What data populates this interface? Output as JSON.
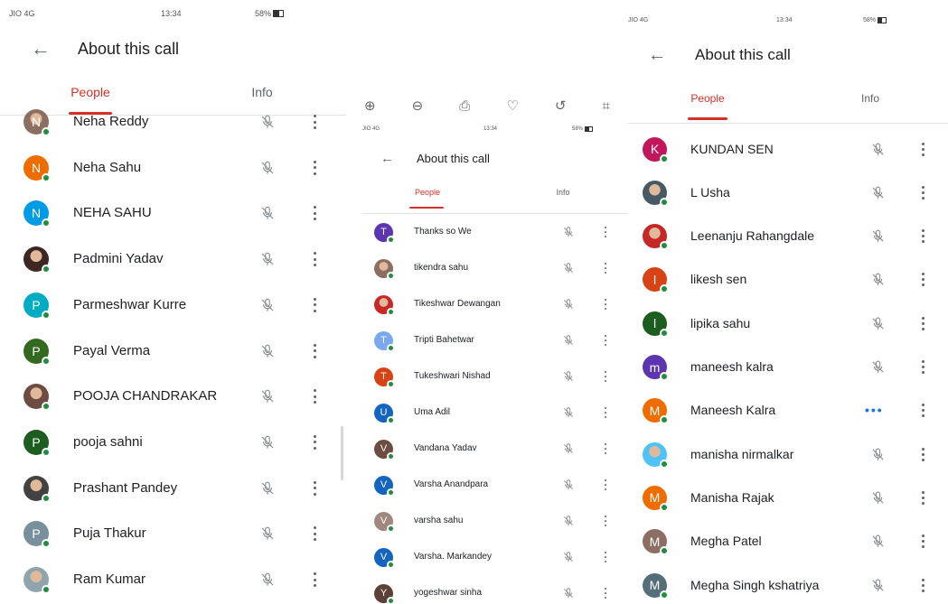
{
  "left": {
    "status": {
      "carrier": "JIO 4G",
      "time": "13:34",
      "battery": "58%"
    },
    "title": "About this call",
    "tabs": [
      "People",
      "Info"
    ],
    "people": [
      {
        "name": "Neha Reddy",
        "initial": "N",
        "color": "#8d6e63",
        "kind": "photo"
      },
      {
        "name": "Neha Sahu",
        "initial": "N",
        "color": "#ef6c00",
        "kind": "letter"
      },
      {
        "name": "NEHA SAHU",
        "initial": "N",
        "color": "#039be5",
        "kind": "letter"
      },
      {
        "name": "Padmini Yadav",
        "initial": "",
        "color": "#3e2723",
        "kind": "photo"
      },
      {
        "name": "Parmeshwar Kurre",
        "initial": "P",
        "color": "#00acc1",
        "kind": "letter"
      },
      {
        "name": "Payal Verma",
        "initial": "P",
        "color": "#33691e",
        "kind": "letter"
      },
      {
        "name": "POOJA CHANDRAKAR",
        "initial": "",
        "color": "#6d4c41",
        "kind": "photo"
      },
      {
        "name": "pooja sahni",
        "initial": "P",
        "color": "#1b5e20",
        "kind": "letter"
      },
      {
        "name": "Prashant Pandey",
        "initial": "",
        "color": "#424242",
        "kind": "photo"
      },
      {
        "name": "Puja Thakur",
        "initial": "P",
        "color": "#78909c",
        "kind": "letter"
      },
      {
        "name": "Ram Kumar",
        "initial": "",
        "color": "#90a4ae",
        "kind": "photo"
      }
    ]
  },
  "middle": {
    "toolbar": [
      "zoom-in",
      "zoom-out",
      "delete",
      "favorite",
      "rotate",
      "crop"
    ],
    "status": {
      "carrier": "JIO 4G",
      "time": "13:34",
      "battery": "58%"
    },
    "title": "About this call",
    "tabs": [
      "People",
      "Info"
    ],
    "people": [
      {
        "name": "Thanks so We",
        "initial": "T",
        "color": "#5e35b1",
        "kind": "letter"
      },
      {
        "name": "tikendra sahu",
        "initial": "",
        "color": "#8d6e63",
        "kind": "photo"
      },
      {
        "name": "Tikeshwar Dewangan",
        "initial": "",
        "color": "#c62828",
        "kind": "photo"
      },
      {
        "name": "Tripti Bahetwar",
        "initial": "T",
        "color": "#7aa7ee",
        "kind": "letter"
      },
      {
        "name": "Tukeshwari Nishad",
        "initial": "T",
        "color": "#d84315",
        "kind": "letter"
      },
      {
        "name": "Uma Adil",
        "initial": "U",
        "color": "#1565c0",
        "kind": "letter"
      },
      {
        "name": "Vandana Yadav",
        "initial": "V",
        "color": "#6d4c41",
        "kind": "letter"
      },
      {
        "name": "Varsha Anandpara",
        "initial": "V",
        "color": "#1565c0",
        "kind": "letter"
      },
      {
        "name": "varsha sahu",
        "initial": "V",
        "color": "#a1887f",
        "kind": "letter"
      },
      {
        "name": "Varsha. Markandey",
        "initial": "V",
        "color": "#1565c0",
        "kind": "letter"
      },
      {
        "name": "yogeshwar sinha",
        "initial": "Y",
        "color": "#5d4037",
        "kind": "letter"
      }
    ]
  },
  "right": {
    "status": {
      "carrier": "JIO 4G",
      "time": "13:34",
      "battery": "58%"
    },
    "title": "About this call",
    "tabs": [
      "People",
      "Info"
    ],
    "people": [
      {
        "name": "KUNDAN SEN",
        "initial": "K",
        "color": "#c2185b",
        "kind": "letter",
        "talking": false
      },
      {
        "name": "L Usha",
        "initial": "",
        "color": "#455a64",
        "kind": "photo",
        "talking": false
      },
      {
        "name": "Leenanju Rahangdale",
        "initial": "",
        "color": "#c62828",
        "kind": "photo",
        "talking": false
      },
      {
        "name": "likesh sen",
        "initial": "l",
        "color": "#d84315",
        "kind": "letter",
        "talking": false
      },
      {
        "name": "lipika sahu",
        "initial": "l",
        "color": "#1b5e20",
        "kind": "letter",
        "talking": false
      },
      {
        "name": "maneesh kalra",
        "initial": "m",
        "color": "#5e35b1",
        "kind": "letter",
        "talking": false
      },
      {
        "name": "Maneesh Kalra",
        "initial": "M",
        "color": "#ef6c00",
        "kind": "letter",
        "talking": true
      },
      {
        "name": "manisha nirmalkar",
        "initial": "",
        "color": "#4fc3f7",
        "kind": "photo",
        "talking": false
      },
      {
        "name": "Manisha Rajak",
        "initial": "M",
        "color": "#ef6c00",
        "kind": "letter",
        "talking": false
      },
      {
        "name": "Megha Patel",
        "initial": "M",
        "color": "#8d6e63",
        "kind": "letter",
        "talking": false
      },
      {
        "name": "Megha Singh kshatriya",
        "initial": "M",
        "color": "#546e7a",
        "kind": "letter",
        "talking": false
      }
    ]
  }
}
